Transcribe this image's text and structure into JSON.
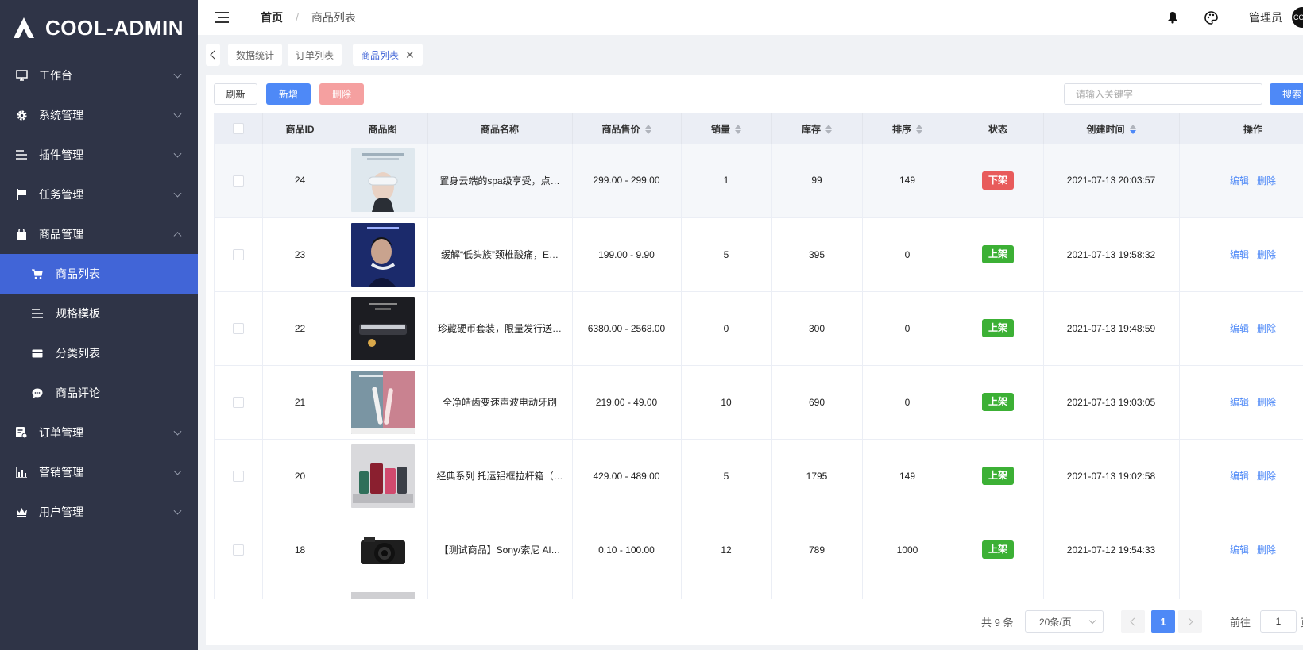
{
  "app": {
    "logo_text": "COOL-ADMIN"
  },
  "sidebar": {
    "menus": [
      {
        "label": "工作台",
        "icon": "monitor-icon"
      },
      {
        "label": "系统管理",
        "icon": "gear-icon"
      },
      {
        "label": "插件管理",
        "icon": "list-icon"
      },
      {
        "label": "任务管理",
        "icon": "flag-icon"
      },
      {
        "label": "商品管理",
        "icon": "bag-icon",
        "expanded": true
      },
      {
        "label": "订单管理",
        "icon": "order-icon"
      },
      {
        "label": "营销管理",
        "icon": "bar-chart-icon"
      },
      {
        "label": "用户管理",
        "icon": "crown-icon"
      }
    ],
    "submenu": [
      {
        "label": "商品列表",
        "icon": "cart-icon",
        "active": true
      },
      {
        "label": "规格模板",
        "icon": "list-icon"
      },
      {
        "label": "分类列表",
        "icon": "card-icon"
      },
      {
        "label": "商品评论",
        "icon": "chat-icon"
      }
    ]
  },
  "topbar": {
    "breadcrumb_home": "首页",
    "breadcrumb_sep": "/",
    "breadcrumb_current": "商品列表",
    "username": "管理员",
    "avatar_text": "COOL"
  },
  "process_tabs": [
    {
      "label": "数据统计"
    },
    {
      "label": "订单列表"
    },
    {
      "label": "商品列表",
      "active": true,
      "close": "✕"
    }
  ],
  "toolbar": {
    "refresh_label": "刷新",
    "add_label": "新增",
    "delete_label": "删除",
    "search_placeholder": "请输入关键字",
    "search_label": "搜索"
  },
  "table": {
    "headers": {
      "id": "商品ID",
      "image": "商品图",
      "name": "商品名称",
      "price": "商品售价",
      "sales": "销量",
      "stock": "库存",
      "sort": "排序",
      "status": "状态",
      "created": "创建时间",
      "actions": "操作"
    },
    "edit_label": "编辑",
    "remove_label": "删除",
    "rows": [
      {
        "id": "24",
        "name": "置身云端的spa级享受，点…",
        "price": "299.00 - 299.00",
        "sales": "1",
        "stock": "99",
        "sort": "149",
        "status": "下架",
        "status_color": "#e85b5b",
        "created": "2021-07-13 20:03:57",
        "thumb": "thumb-headphones",
        "highlighted": true
      },
      {
        "id": "23",
        "name": "缓解“低头族”颈椎酸痛，E…",
        "price": "199.00 - 9.90",
        "sales": "5",
        "stock": "395",
        "sort": "0",
        "status": "上架",
        "status_color": "#3cb035",
        "created": "2021-07-13 19:58:32",
        "thumb": "thumb-neck-massager"
      },
      {
        "id": "22",
        "name": "珍藏硬币套装，限量发行送…",
        "price": "6380.00 - 2568.00",
        "sales": "0",
        "stock": "300",
        "sort": "0",
        "status": "上架",
        "status_color": "#3cb035",
        "created": "2021-07-13 19:48:59",
        "thumb": "thumb-coin-set"
      },
      {
        "id": "21",
        "name": "全净皓齿变速声波电动牙刷",
        "price": "219.00 - 49.00",
        "sales": "10",
        "stock": "690",
        "sort": "0",
        "status": "上架",
        "status_color": "#3cb035",
        "created": "2021-07-13 19:03:05",
        "thumb": "thumb-toothbrush"
      },
      {
        "id": "20",
        "name": "经典系列 托运铝框拉杆箱（…",
        "price": "429.00 - 489.00",
        "sales": "5",
        "stock": "1795",
        "sort": "149",
        "status": "上架",
        "status_color": "#3cb035",
        "created": "2021-07-13 19:02:58",
        "thumb": "thumb-luggage"
      },
      {
        "id": "18",
        "name": "【测试商品】Sony/索尼 Al…",
        "price": "0.10 - 100.00",
        "sales": "12",
        "stock": "789",
        "sort": "1000",
        "status": "上架",
        "status_color": "#3cb035",
        "created": "2021-07-12 19:54:33",
        "thumb": "thumb-camera"
      }
    ]
  },
  "pagination": {
    "total_text": "共 9 条",
    "page_size": "20条/页",
    "current_page": "1",
    "goto_label": "前往",
    "goto_value": "1",
    "page_suffix": "页"
  },
  "colors": {
    "sidebar_bg": "#2f3447",
    "accent": "#4165d7",
    "primary_button": "#4e89f7",
    "danger": "#e85b5b",
    "success": "#3cb035"
  }
}
